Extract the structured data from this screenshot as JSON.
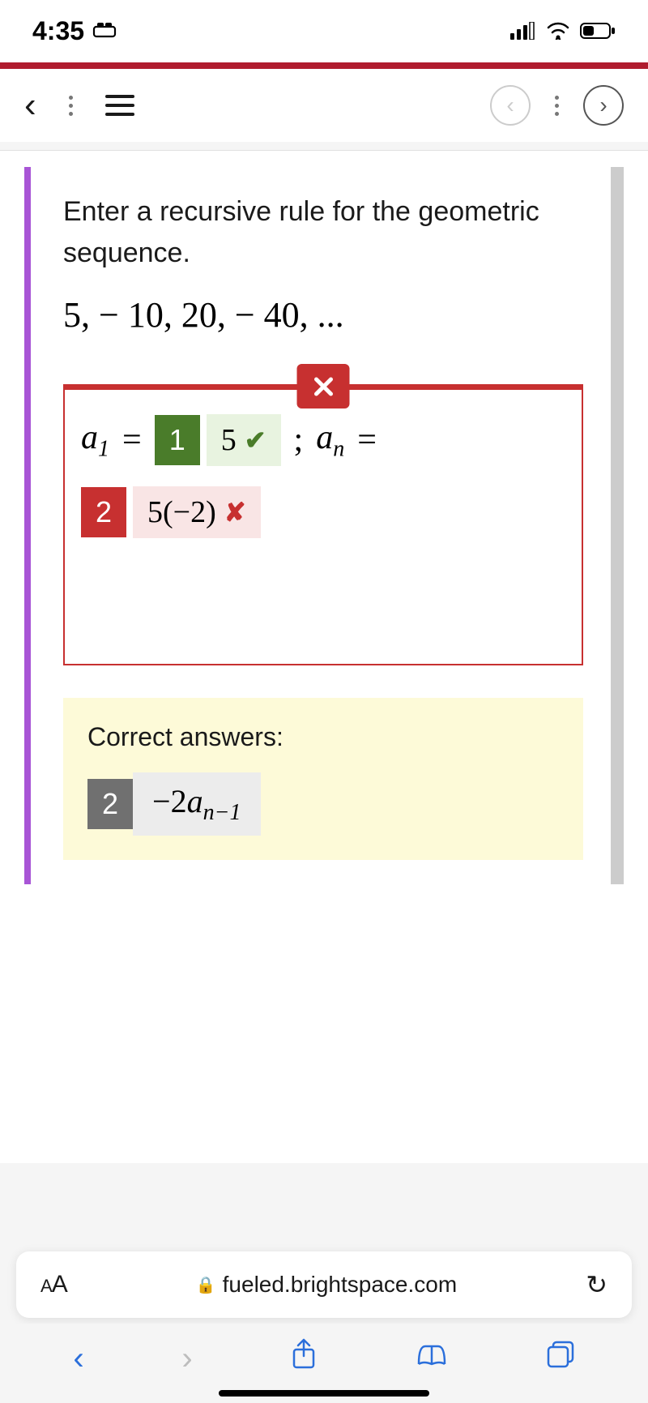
{
  "status": {
    "time": "4:35",
    "carplay_icon": "carplay-icon"
  },
  "question": {
    "prompt": "Enter a recursive rule for the geometric sequence.",
    "sequence": "5,  − 10, 20,  − 40, ..."
  },
  "answer": {
    "a1_label_var": "a",
    "a1_label_sub": "1",
    "equals": "=",
    "blank1_num": "1",
    "blank1_value": "5",
    "semicolon": ";",
    "an_var": "a",
    "an_sub": "n",
    "blank2_num": "2",
    "blank2_value": "5(−2)"
  },
  "correct": {
    "title": "Correct answers:",
    "num": "2",
    "value_prefix": "−2",
    "value_var": "a",
    "value_sub": "n−1"
  },
  "browser": {
    "aa_small": "A",
    "aa_large": "A",
    "url": "fueled.brightspace.com"
  }
}
